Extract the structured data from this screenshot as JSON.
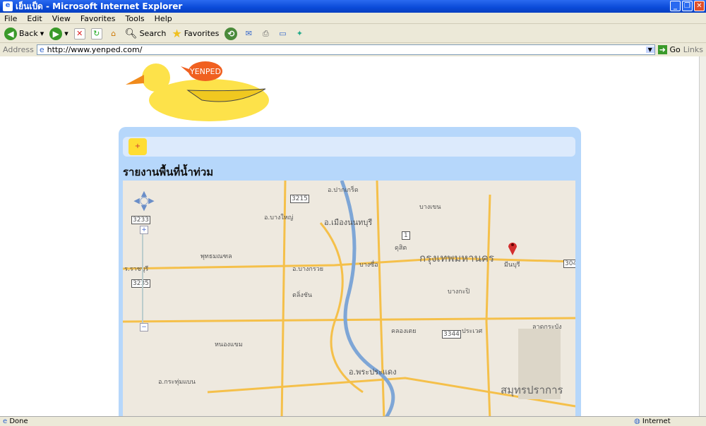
{
  "window": {
    "title": "เย็นเป็ด - Microsoft Internet Explorer"
  },
  "menu": [
    "File",
    "Edit",
    "View",
    "Favorites",
    "Tools",
    "Help"
  ],
  "toolbar": {
    "back": "Back",
    "search": "Search",
    "favorites": "Favorites"
  },
  "address": {
    "label": "Address",
    "url": "http://www.yenped.com/",
    "go": "Go",
    "links": "Links"
  },
  "logo": {
    "text": "YENPED"
  },
  "panel": {
    "add_button": "+",
    "heading": "รายงานพื้นที่น้ำท่วม"
  },
  "map": {
    "labels": [
      "อ.ปากเกร็ด",
      "อ.เมืองนนทบุรี",
      "อ.บางใหญ่",
      "อ.บางกรวย",
      "กรุงเทพมหานคร",
      "มีนบุรี",
      "บางซื่อ",
      "ดุสิต",
      "คลองเตย",
      "อ.พระประแดง",
      "สมุทรปราการ",
      "อ.กระทุ่มแบน",
      "บางเขน",
      "ลาดกระบัง",
      "ตลิ่งชัน",
      "บางกะปิ",
      "ประเวศ",
      "ร.ราชบุรี",
      "พุทธมณฑล",
      "หนองแขม"
    ],
    "route_shields": [
      "3215",
      "3233",
      "3235",
      "304",
      "3344",
      "1"
    ],
    "marker_color": "#d32f2f"
  },
  "status": {
    "left": "Done",
    "zone": "Internet"
  }
}
